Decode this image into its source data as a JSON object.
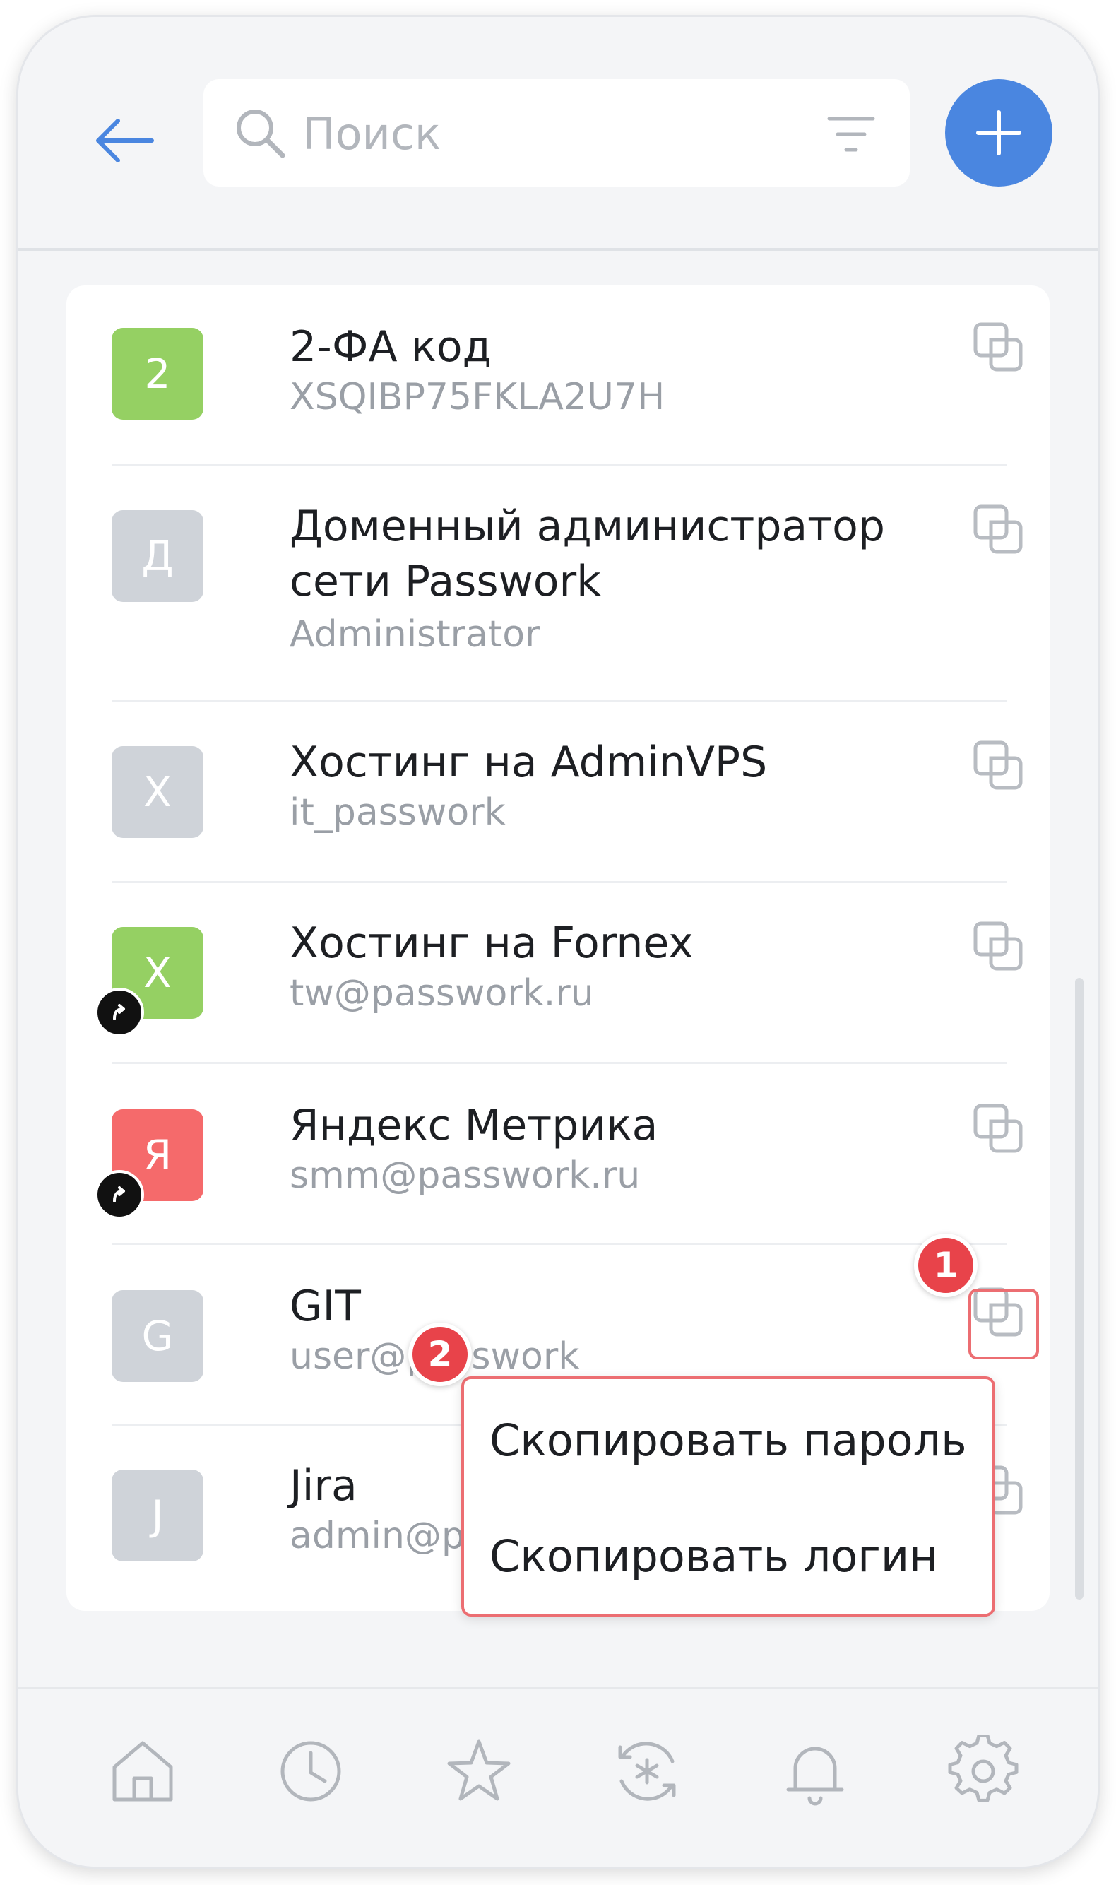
{
  "header": {
    "search_placeholder": "Поиск"
  },
  "items": [
    {
      "avatar_letter": "2",
      "title": "2-ФА код",
      "subtitle": "XSQIBP75FKLA2U7H",
      "avatar_color": "#95d063",
      "shared": false
    },
    {
      "avatar_letter": "Д",
      "title": "Доменный администратор сети Passwork",
      "subtitle": "Administrator",
      "avatar_color": "#cfd3d9",
      "shared": false
    },
    {
      "avatar_letter": "Х",
      "title": "Хостинг на AdminVPS",
      "subtitle": "it_passwork",
      "avatar_color": "#cfd3d9",
      "shared": false
    },
    {
      "avatar_letter": "Х",
      "title": "Хостинг на Fornex",
      "subtitle": "tw@passwork.ru",
      "avatar_color": "#95d063",
      "shared": true
    },
    {
      "avatar_letter": "Я",
      "title": "Яндекс Метрика",
      "subtitle": "smm@passwork.ru",
      "avatar_color": "#f56a6b",
      "shared": true
    },
    {
      "avatar_letter": "G",
      "title": "GIT",
      "subtitle": "user@passwork",
      "avatar_color": "#cfd3d9",
      "shared": false
    },
    {
      "avatar_letter": "J",
      "title": "Jira",
      "subtitle": "admin@passwork",
      "avatar_color": "#cfd3d9",
      "shared": false
    }
  ],
  "dropdown": {
    "copy_password": "Скопировать пароль",
    "copy_login": "Скопировать логин"
  },
  "annotations": {
    "step1": "1",
    "step2": "2"
  },
  "colors": {
    "accent": "#4a86e0",
    "highlight": "#ec6e72",
    "badge": "#e8434a"
  },
  "nav_icons": [
    "home-icon",
    "clock-icon",
    "star-icon",
    "generator-icon",
    "bell-icon",
    "gear-icon"
  ]
}
